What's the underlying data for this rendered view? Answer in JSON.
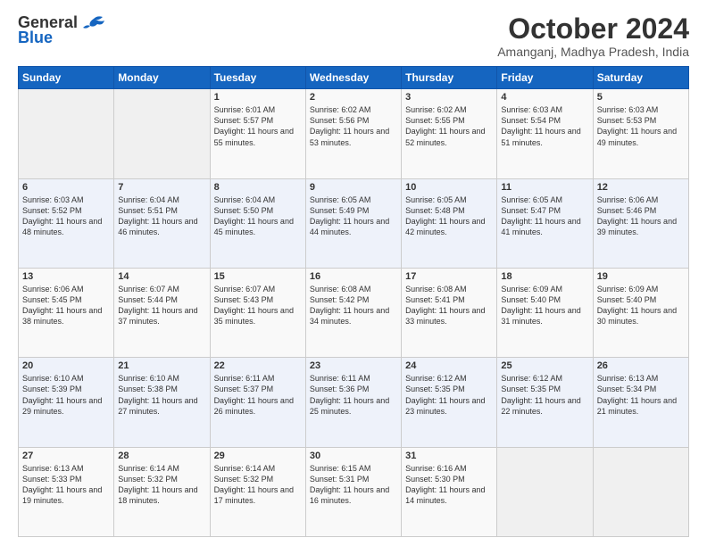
{
  "logo": {
    "line1": "General",
    "line2": "Blue"
  },
  "header": {
    "title": "October 2024",
    "location": "Amanganj, Madhya Pradesh, India"
  },
  "days_of_week": [
    "Sunday",
    "Monday",
    "Tuesday",
    "Wednesday",
    "Thursday",
    "Friday",
    "Saturday"
  ],
  "weeks": [
    [
      {
        "num": "",
        "info": ""
      },
      {
        "num": "",
        "info": ""
      },
      {
        "num": "1",
        "info": "Sunrise: 6:01 AM\nSunset: 5:57 PM\nDaylight: 11 hours and 55 minutes."
      },
      {
        "num": "2",
        "info": "Sunrise: 6:02 AM\nSunset: 5:56 PM\nDaylight: 11 hours and 53 minutes."
      },
      {
        "num": "3",
        "info": "Sunrise: 6:02 AM\nSunset: 5:55 PM\nDaylight: 11 hours and 52 minutes."
      },
      {
        "num": "4",
        "info": "Sunrise: 6:03 AM\nSunset: 5:54 PM\nDaylight: 11 hours and 51 minutes."
      },
      {
        "num": "5",
        "info": "Sunrise: 6:03 AM\nSunset: 5:53 PM\nDaylight: 11 hours and 49 minutes."
      }
    ],
    [
      {
        "num": "6",
        "info": "Sunrise: 6:03 AM\nSunset: 5:52 PM\nDaylight: 11 hours and 48 minutes."
      },
      {
        "num": "7",
        "info": "Sunrise: 6:04 AM\nSunset: 5:51 PM\nDaylight: 11 hours and 46 minutes."
      },
      {
        "num": "8",
        "info": "Sunrise: 6:04 AM\nSunset: 5:50 PM\nDaylight: 11 hours and 45 minutes."
      },
      {
        "num": "9",
        "info": "Sunrise: 6:05 AM\nSunset: 5:49 PM\nDaylight: 11 hours and 44 minutes."
      },
      {
        "num": "10",
        "info": "Sunrise: 6:05 AM\nSunset: 5:48 PM\nDaylight: 11 hours and 42 minutes."
      },
      {
        "num": "11",
        "info": "Sunrise: 6:05 AM\nSunset: 5:47 PM\nDaylight: 11 hours and 41 minutes."
      },
      {
        "num": "12",
        "info": "Sunrise: 6:06 AM\nSunset: 5:46 PM\nDaylight: 11 hours and 39 minutes."
      }
    ],
    [
      {
        "num": "13",
        "info": "Sunrise: 6:06 AM\nSunset: 5:45 PM\nDaylight: 11 hours and 38 minutes."
      },
      {
        "num": "14",
        "info": "Sunrise: 6:07 AM\nSunset: 5:44 PM\nDaylight: 11 hours and 37 minutes."
      },
      {
        "num": "15",
        "info": "Sunrise: 6:07 AM\nSunset: 5:43 PM\nDaylight: 11 hours and 35 minutes."
      },
      {
        "num": "16",
        "info": "Sunrise: 6:08 AM\nSunset: 5:42 PM\nDaylight: 11 hours and 34 minutes."
      },
      {
        "num": "17",
        "info": "Sunrise: 6:08 AM\nSunset: 5:41 PM\nDaylight: 11 hours and 33 minutes."
      },
      {
        "num": "18",
        "info": "Sunrise: 6:09 AM\nSunset: 5:40 PM\nDaylight: 11 hours and 31 minutes."
      },
      {
        "num": "19",
        "info": "Sunrise: 6:09 AM\nSunset: 5:40 PM\nDaylight: 11 hours and 30 minutes."
      }
    ],
    [
      {
        "num": "20",
        "info": "Sunrise: 6:10 AM\nSunset: 5:39 PM\nDaylight: 11 hours and 29 minutes."
      },
      {
        "num": "21",
        "info": "Sunrise: 6:10 AM\nSunset: 5:38 PM\nDaylight: 11 hours and 27 minutes."
      },
      {
        "num": "22",
        "info": "Sunrise: 6:11 AM\nSunset: 5:37 PM\nDaylight: 11 hours and 26 minutes."
      },
      {
        "num": "23",
        "info": "Sunrise: 6:11 AM\nSunset: 5:36 PM\nDaylight: 11 hours and 25 minutes."
      },
      {
        "num": "24",
        "info": "Sunrise: 6:12 AM\nSunset: 5:35 PM\nDaylight: 11 hours and 23 minutes."
      },
      {
        "num": "25",
        "info": "Sunrise: 6:12 AM\nSunset: 5:35 PM\nDaylight: 11 hours and 22 minutes."
      },
      {
        "num": "26",
        "info": "Sunrise: 6:13 AM\nSunset: 5:34 PM\nDaylight: 11 hours and 21 minutes."
      }
    ],
    [
      {
        "num": "27",
        "info": "Sunrise: 6:13 AM\nSunset: 5:33 PM\nDaylight: 11 hours and 19 minutes."
      },
      {
        "num": "28",
        "info": "Sunrise: 6:14 AM\nSunset: 5:32 PM\nDaylight: 11 hours and 18 minutes."
      },
      {
        "num": "29",
        "info": "Sunrise: 6:14 AM\nSunset: 5:32 PM\nDaylight: 11 hours and 17 minutes."
      },
      {
        "num": "30",
        "info": "Sunrise: 6:15 AM\nSunset: 5:31 PM\nDaylight: 11 hours and 16 minutes."
      },
      {
        "num": "31",
        "info": "Sunrise: 6:16 AM\nSunset: 5:30 PM\nDaylight: 11 hours and 14 minutes."
      },
      {
        "num": "",
        "info": ""
      },
      {
        "num": "",
        "info": ""
      }
    ]
  ]
}
